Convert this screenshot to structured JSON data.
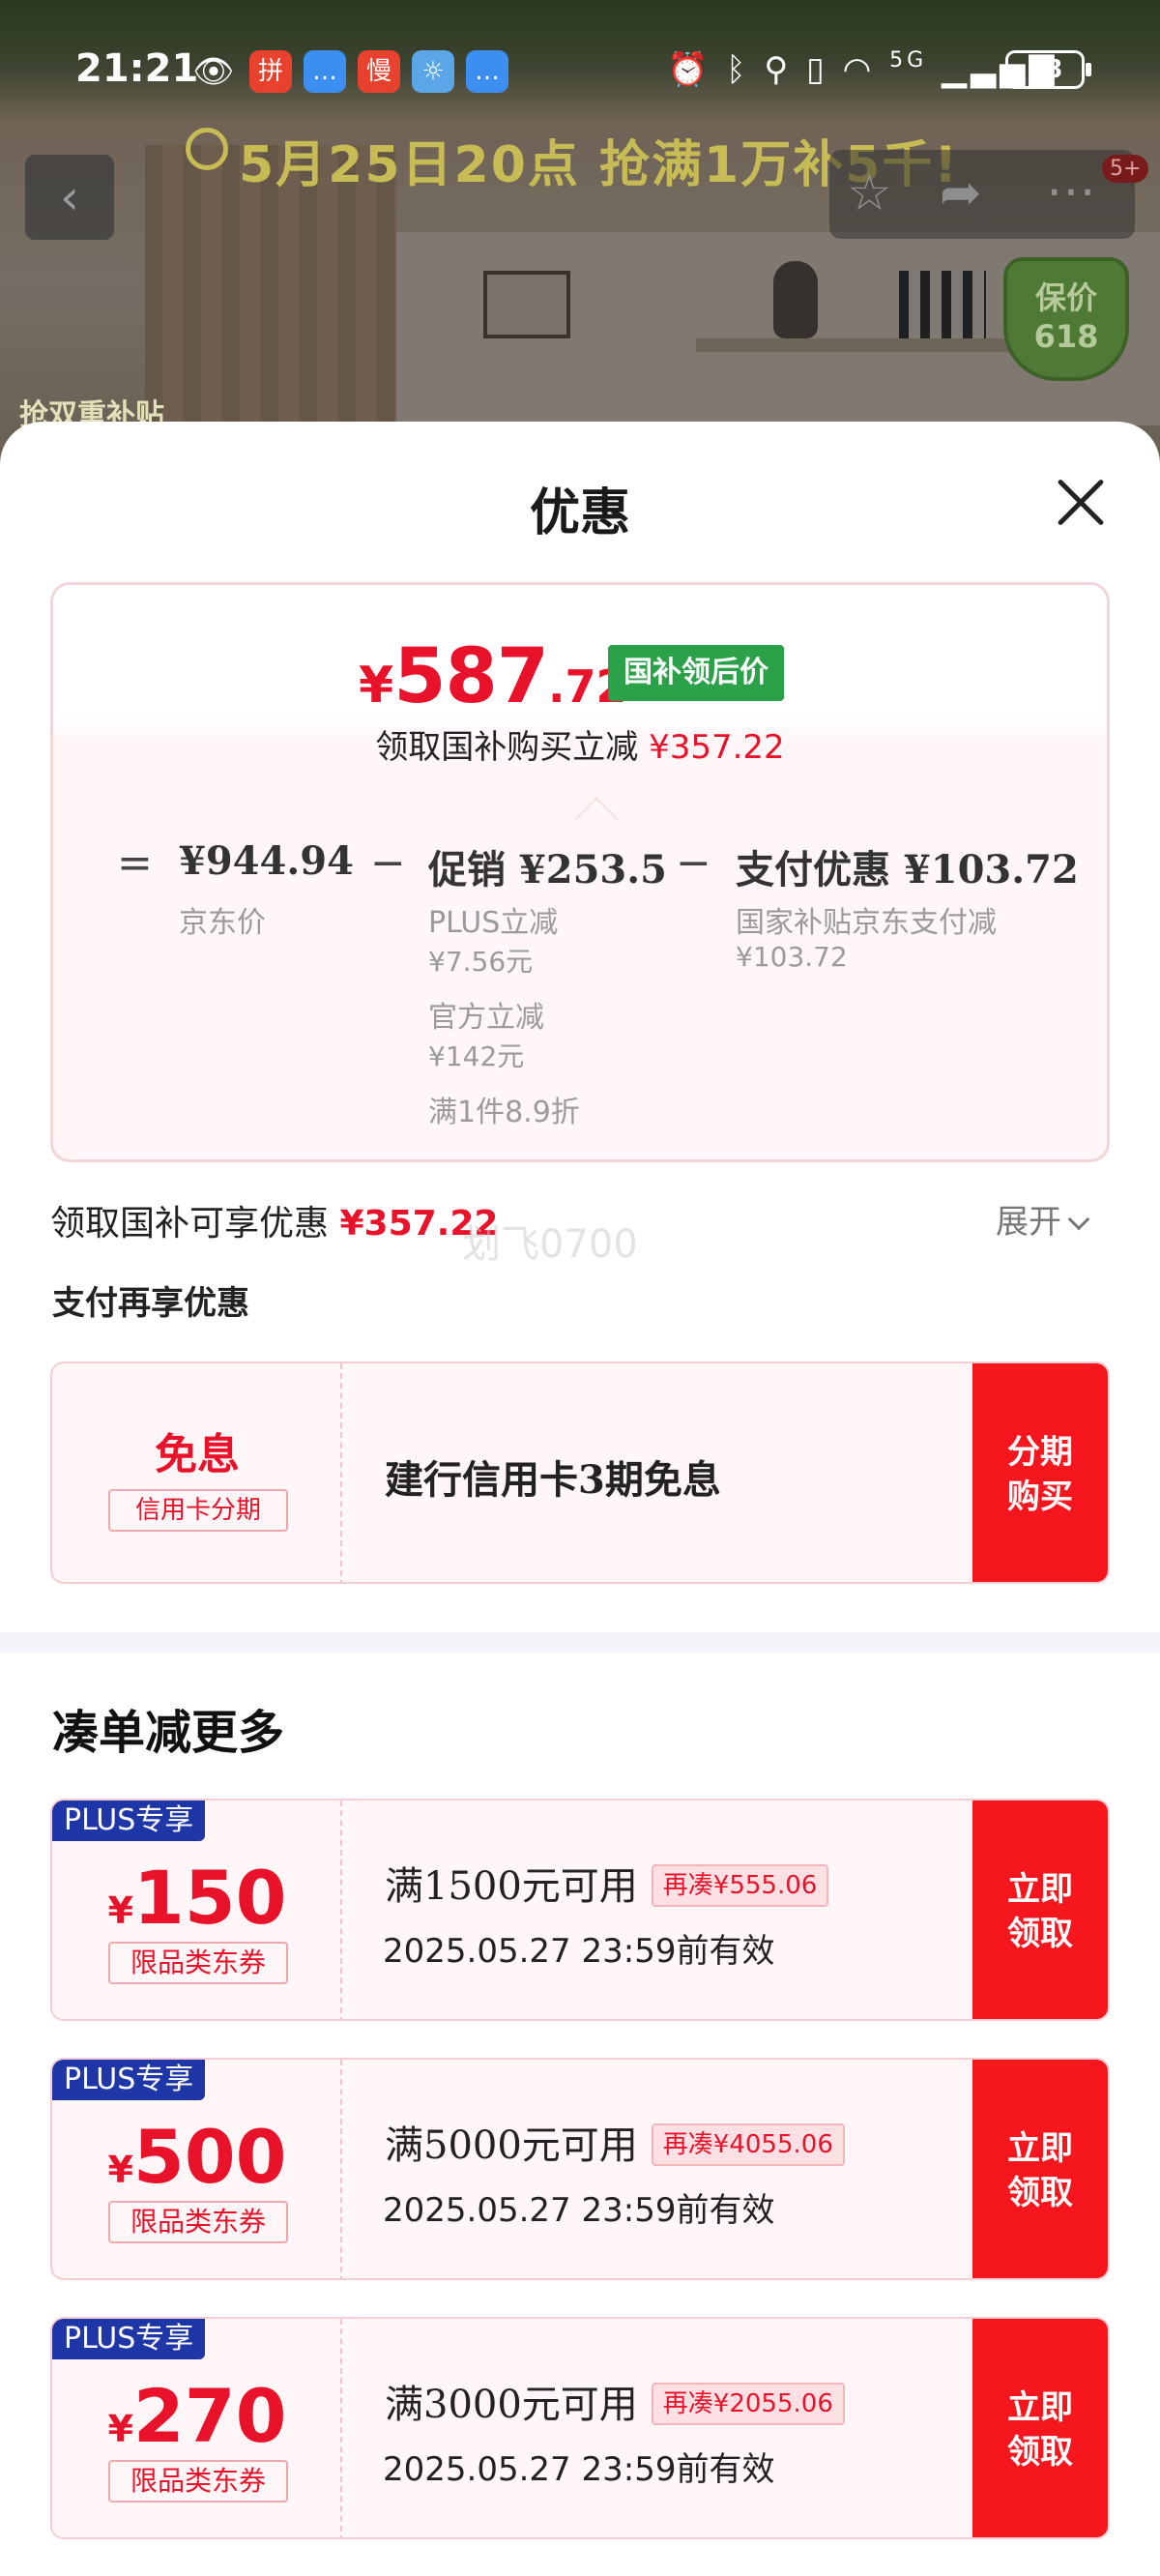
{
  "status_bar": {
    "time": "21:21",
    "battery": "38",
    "apps": [
      {
        "icon": "pinduoduo-icon",
        "glyph": "拼",
        "color": "#e8412e"
      },
      {
        "icon": "message-icon",
        "glyph": "…",
        "color": "#3c8ef0"
      },
      {
        "icon": "slow-app-icon",
        "glyph": "慢",
        "color": "#e8412e"
      },
      {
        "icon": "weather-icon",
        "glyph": "☼",
        "color": "#5aa6e8"
      },
      {
        "icon": "message-icon",
        "glyph": "…",
        "color": "#3c8ef0"
      }
    ],
    "signal_text": "5G"
  },
  "background": {
    "promo_text": "5月25日20点 抢满1万补5千!",
    "price_guard_top": "保价",
    "price_guard_bottom": "618",
    "subsidy_text": "抢双重补贴",
    "badge": "5+"
  },
  "sheet": {
    "title": "优惠",
    "price_card": {
      "price_yen": "¥",
      "price_int": "587",
      "price_dec": ".72",
      "tag": "国补领后价",
      "desc_prefix": "领取国补购买立减",
      "desc_amount": "¥357.22",
      "breakdown": {
        "eq": "=",
        "minus1": "−",
        "minus2": "−",
        "jd_price": "¥944.94",
        "jd_label": "京东价",
        "promo_main": "促销 ¥253.5",
        "plus_label": "PLUS立减",
        "plus_amount": "¥7.56元",
        "official_label": "官方立减",
        "official_amount": "¥142元",
        "discount_rule": "满1件8.9折",
        "pay_main": "支付优惠 ¥103.72",
        "pay_label": "国家补贴京东支付减",
        "pay_amount": "¥103.72"
      }
    },
    "gov_line_prefix": "领取国补可享优惠",
    "gov_line_amount": "¥357.22",
    "expand_label": "展开",
    "watermark": "划飞0700",
    "pay_section_label": "支付再享优惠",
    "installment": {
      "title": "免息",
      "tag": "信用卡分期",
      "text": "建行信用卡3期免息",
      "action_line1": "分期",
      "action_line2": "购买"
    },
    "more_title": "凑单减更多",
    "coupons": [
      {
        "plus": "PLUS专享",
        "yen": "¥",
        "amount": "150",
        "type": "限品类东券",
        "cond": "满1500元可用",
        "more": "再凑¥555.06",
        "expiry": "2025.05.27 23:59前有效",
        "action_line1": "立即",
        "action_line2": "领取"
      },
      {
        "plus": "PLUS专享",
        "yen": "¥",
        "amount": "500",
        "type": "限品类东券",
        "cond": "满5000元可用",
        "more": "再凑¥4055.06",
        "expiry": "2025.05.27 23:59前有效",
        "action_line1": "立即",
        "action_line2": "领取"
      },
      {
        "plus": "PLUS专享",
        "yen": "¥",
        "amount": "270",
        "type": "限品类东券",
        "cond": "满3000元可用",
        "more": "再凑¥2055.06",
        "expiry": "2025.05.27 23:59前有效",
        "action_line1": "立即",
        "action_line2": "领取"
      }
    ]
  },
  "colors": {
    "accent_red": "#e8132a",
    "action_red": "#f5161e",
    "tag_green": "#2ba24a",
    "plus_blue": "#1e36a6"
  }
}
